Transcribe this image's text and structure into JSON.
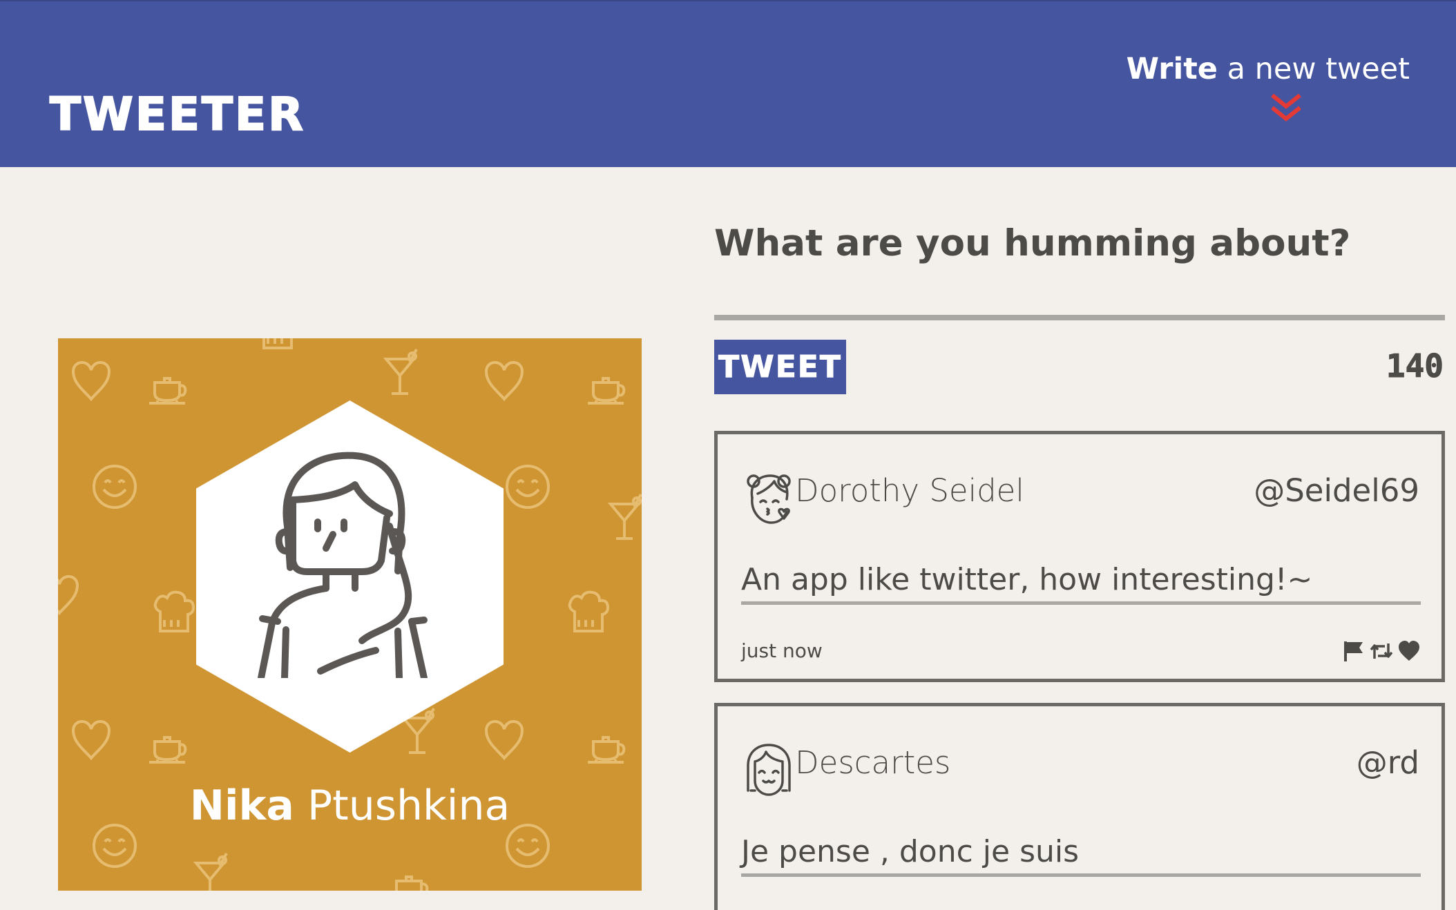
{
  "header": {
    "brand": "TWEETER",
    "write_strong": "Write",
    "write_rest": " a new tweet"
  },
  "profile": {
    "first_name": "Nika",
    "last_name": "Ptushkina"
  },
  "compose": {
    "title": "What are you humming about?",
    "input_value": "",
    "tweet_button": "TWEET",
    "counter": "140"
  },
  "tweets": [
    {
      "name": "Dorothy Seidel",
      "handle": "@Seidel69",
      "text": "An app like twitter, how interesting!~",
      "time": "just now",
      "avatar_icon": "girl-blowing-kiss-avatar-icon"
    },
    {
      "name": "Descartes",
      "handle": "@rd",
      "text": "Je pense , donc je suis",
      "time": "",
      "avatar_icon": "smiling-person-avatar-icon"
    }
  ],
  "colors": {
    "header_bg": "#4655a0",
    "page_bg": "#f3f0ec",
    "profile_bg": "#cf9532",
    "text": "#4d4b48",
    "chevron": "#e53935"
  }
}
